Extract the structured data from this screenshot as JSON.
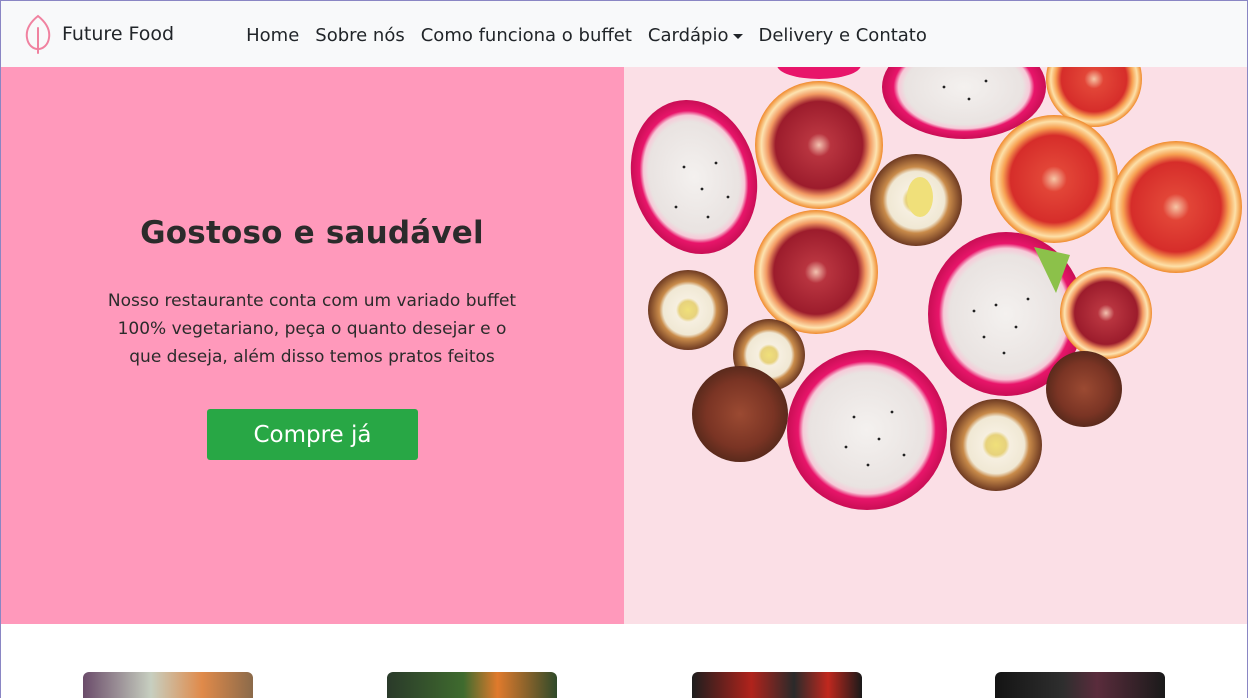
{
  "navbar": {
    "brand_name": "Future Food",
    "links": [
      {
        "label": "Home"
      },
      {
        "label": "Sobre nós"
      },
      {
        "label": "Como funciona o buffet"
      },
      {
        "label": "Cardápio",
        "dropdown": true
      },
      {
        "label": "Delivery e Contato"
      }
    ]
  },
  "hero": {
    "title": "Gostoso e saudável",
    "text": "Nosso restaurante conta com um variado buffet 100% vegetariano, peça o quanto desejar e o que deseja, além disso temos pratos feitos",
    "button_label": "Compre já"
  },
  "colors": {
    "hero_background": "#ff99bb",
    "button": "#28a745",
    "navbar_background": "#f8f9fa",
    "brand_logo": "#f082a0"
  },
  "icons": {
    "brand": "leaf-icon",
    "dropdown": "caret-down-icon"
  }
}
